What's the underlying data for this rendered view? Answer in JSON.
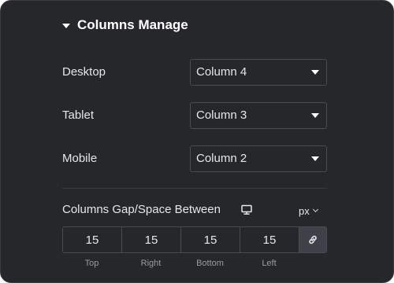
{
  "section": {
    "title": "Columns Manage",
    "caret_icon": "caret-down-icon"
  },
  "rows": [
    {
      "label": "Desktop",
      "value": "Column 4"
    },
    {
      "label": "Tablet",
      "value": "Column 3"
    },
    {
      "label": "Mobile",
      "value": "Column 2"
    }
  ],
  "gap": {
    "label": "Columns Gap/Space Between",
    "device_icon": "monitor-icon",
    "unit": "px",
    "values": {
      "top": "15",
      "right": "15",
      "bottom": "15",
      "left": "15"
    },
    "labels": {
      "top": "Top",
      "right": "Right",
      "bottom": "Bottom",
      "left": "Left"
    },
    "link_icon": "link-icon"
  },
  "colors": {
    "panel_background": "#26272b",
    "border": "#4a4b50",
    "text": "#e6e7ea",
    "muted_text": "#9a9ba0",
    "link_button_background": "#404148"
  }
}
